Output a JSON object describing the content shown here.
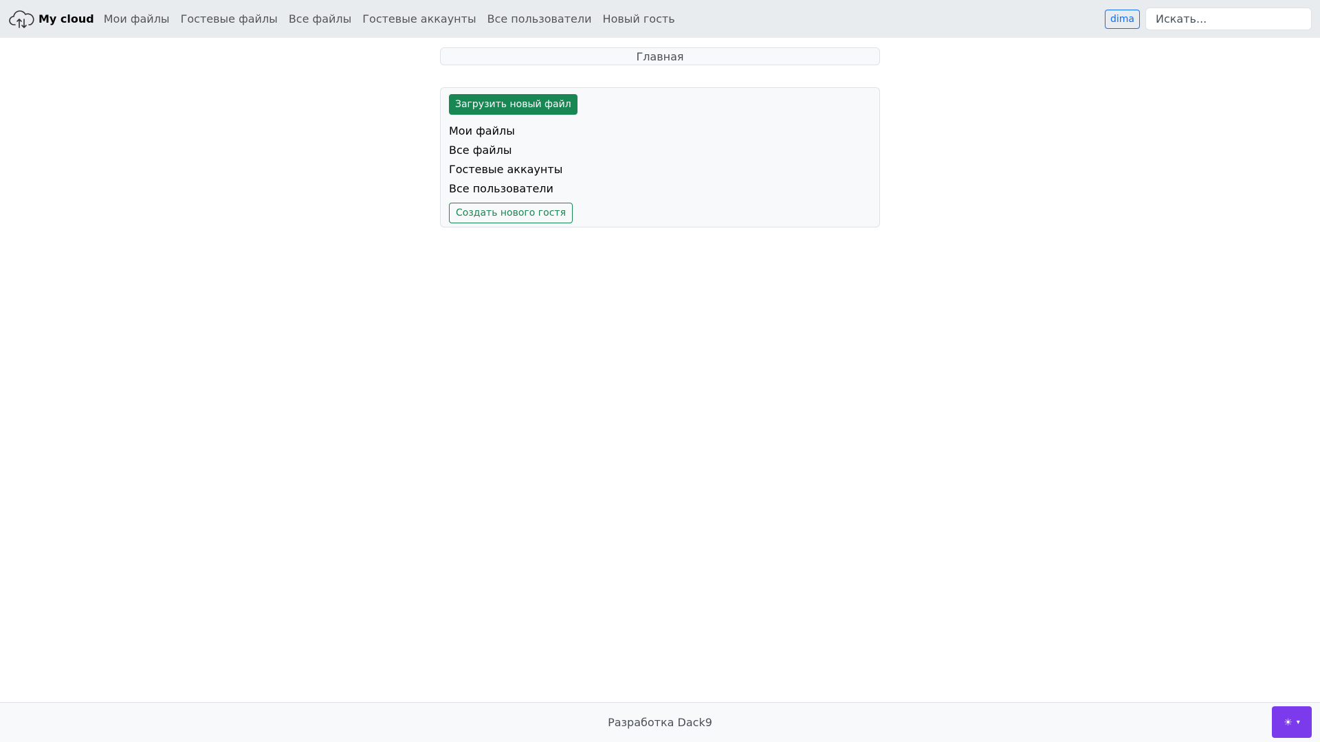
{
  "navbar": {
    "brand_label": "My cloud",
    "brand_icon": "cloud-upload-download-icon",
    "links": [
      {
        "label": "Мои файлы"
      },
      {
        "label": "Гостевые файлы"
      },
      {
        "label": "Все файлы"
      },
      {
        "label": "Гостевые аккаунты"
      },
      {
        "label": "Все пользователи"
      },
      {
        "label": "Новый гость"
      }
    ],
    "user_label": "dima",
    "search_placeholder": "Искать..."
  },
  "breadcrumb": {
    "label": "Главная"
  },
  "panel": {
    "upload_button_label": "Загрузить новый файл",
    "links": [
      {
        "label": "Мои файлы"
      },
      {
        "label": "Все файлы"
      },
      {
        "label": "Гостевые аккаунты"
      },
      {
        "label": "Все пользователи"
      }
    ],
    "new_guest_button_label": "Создать нового гостя"
  },
  "footer": {
    "text": "Разработка Dack9"
  },
  "theme_toggle": {
    "icon": "sun-icon",
    "icon_glyph": "☀",
    "caret_glyph": "▾"
  },
  "colors": {
    "primary": "#0d6efd",
    "success": "#198754",
    "theme_toggle": "#7c3aed",
    "navbar_bg": "#e9ecef"
  }
}
